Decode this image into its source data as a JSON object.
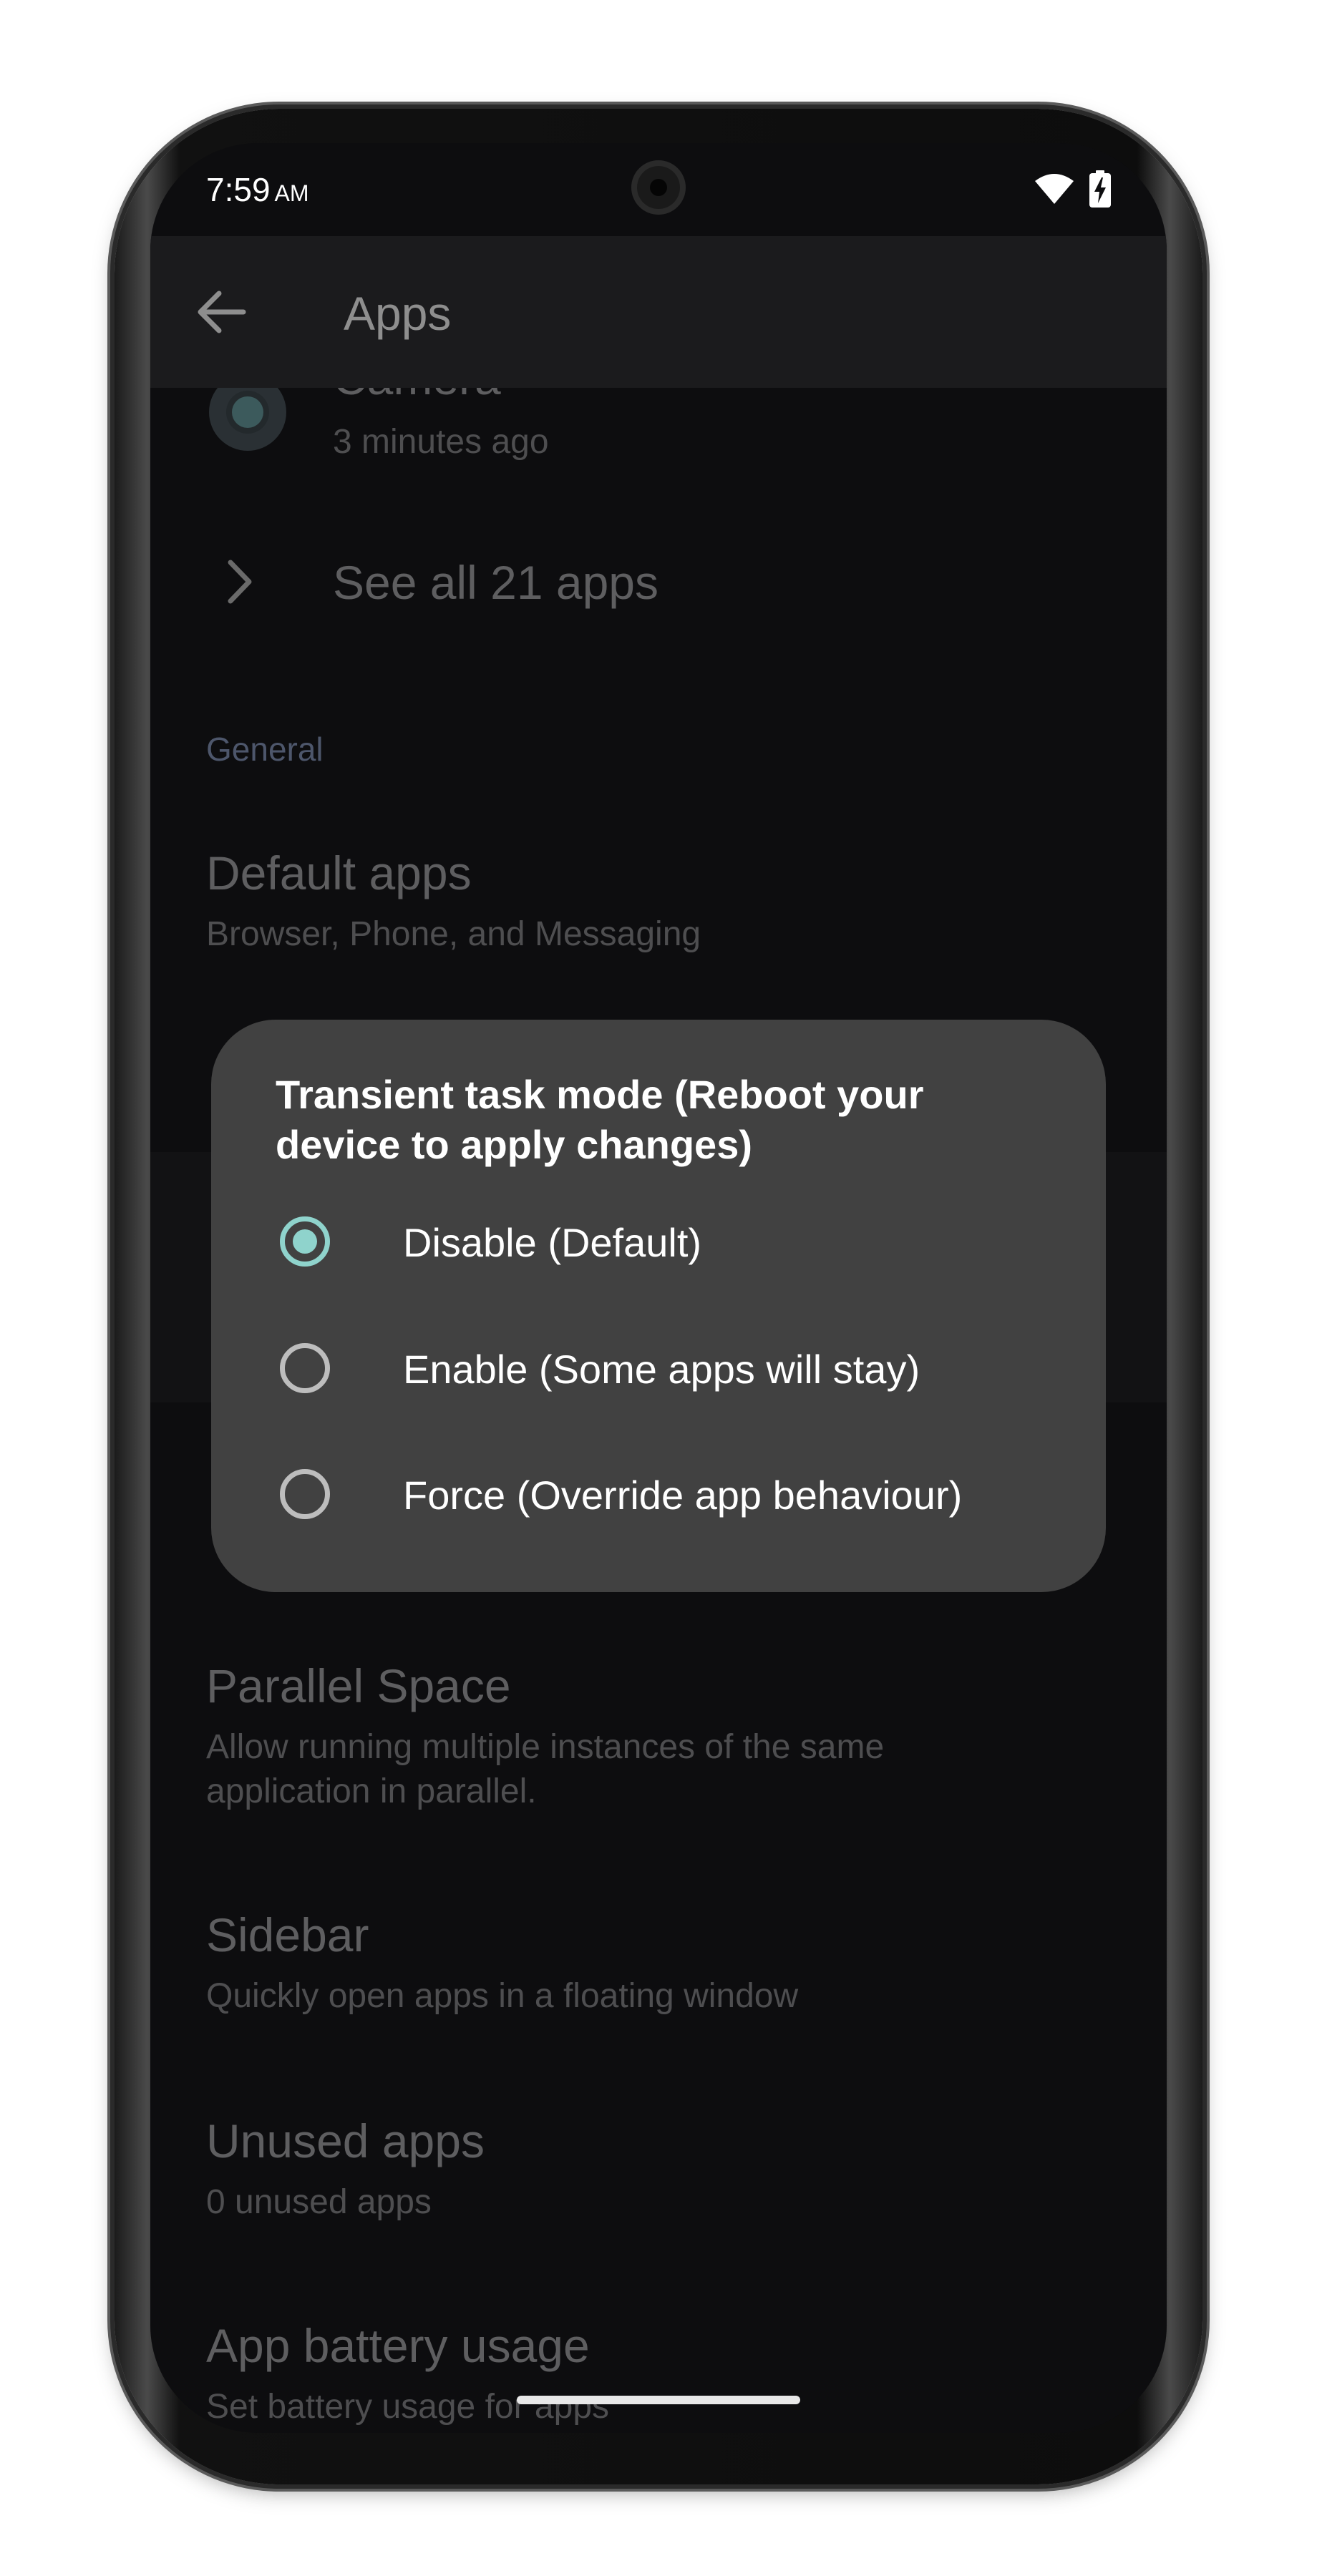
{
  "status_bar": {
    "time": "7:59",
    "ampm": "AM",
    "icons": [
      "wifi-icon",
      "battery-charging-icon"
    ]
  },
  "app_bar": {
    "back_icon": "arrow-left-icon",
    "title": "Apps"
  },
  "recent_app": {
    "name": "Camera",
    "time": "3 minutes ago",
    "icon": "camera-icon"
  },
  "see_all": {
    "label": "See all 21 apps",
    "icon": "chevron-right-icon"
  },
  "section": {
    "label": "General"
  },
  "items": [
    {
      "title": "Default apps",
      "subtitle": "Browser, Phone, and Messaging"
    },
    {
      "title": "Parallel Space",
      "subtitle_line1": "Allow running multiple instances of the same",
      "subtitle_line2": "application in parallel."
    },
    {
      "title": "Sidebar",
      "subtitle": "Quickly open apps in a floating window"
    },
    {
      "title": "Unused apps",
      "subtitle": "0 unused apps"
    },
    {
      "title": "App battery usage",
      "subtitle": "Set battery usage for apps"
    }
  ],
  "dialog": {
    "title_line1": "Transient task mode (Reboot your",
    "title_line2": "device to apply changes)",
    "selected_index": 0,
    "options": [
      {
        "label": "Disable (Default)"
      },
      {
        "label": "Enable (Some apps will stay)"
      },
      {
        "label": "Force (Override app behaviour)"
      }
    ]
  },
  "colors": {
    "accent": "#8fd3cc",
    "dialog_bg": "#414141",
    "screen_bg": "#0d0d0f"
  }
}
